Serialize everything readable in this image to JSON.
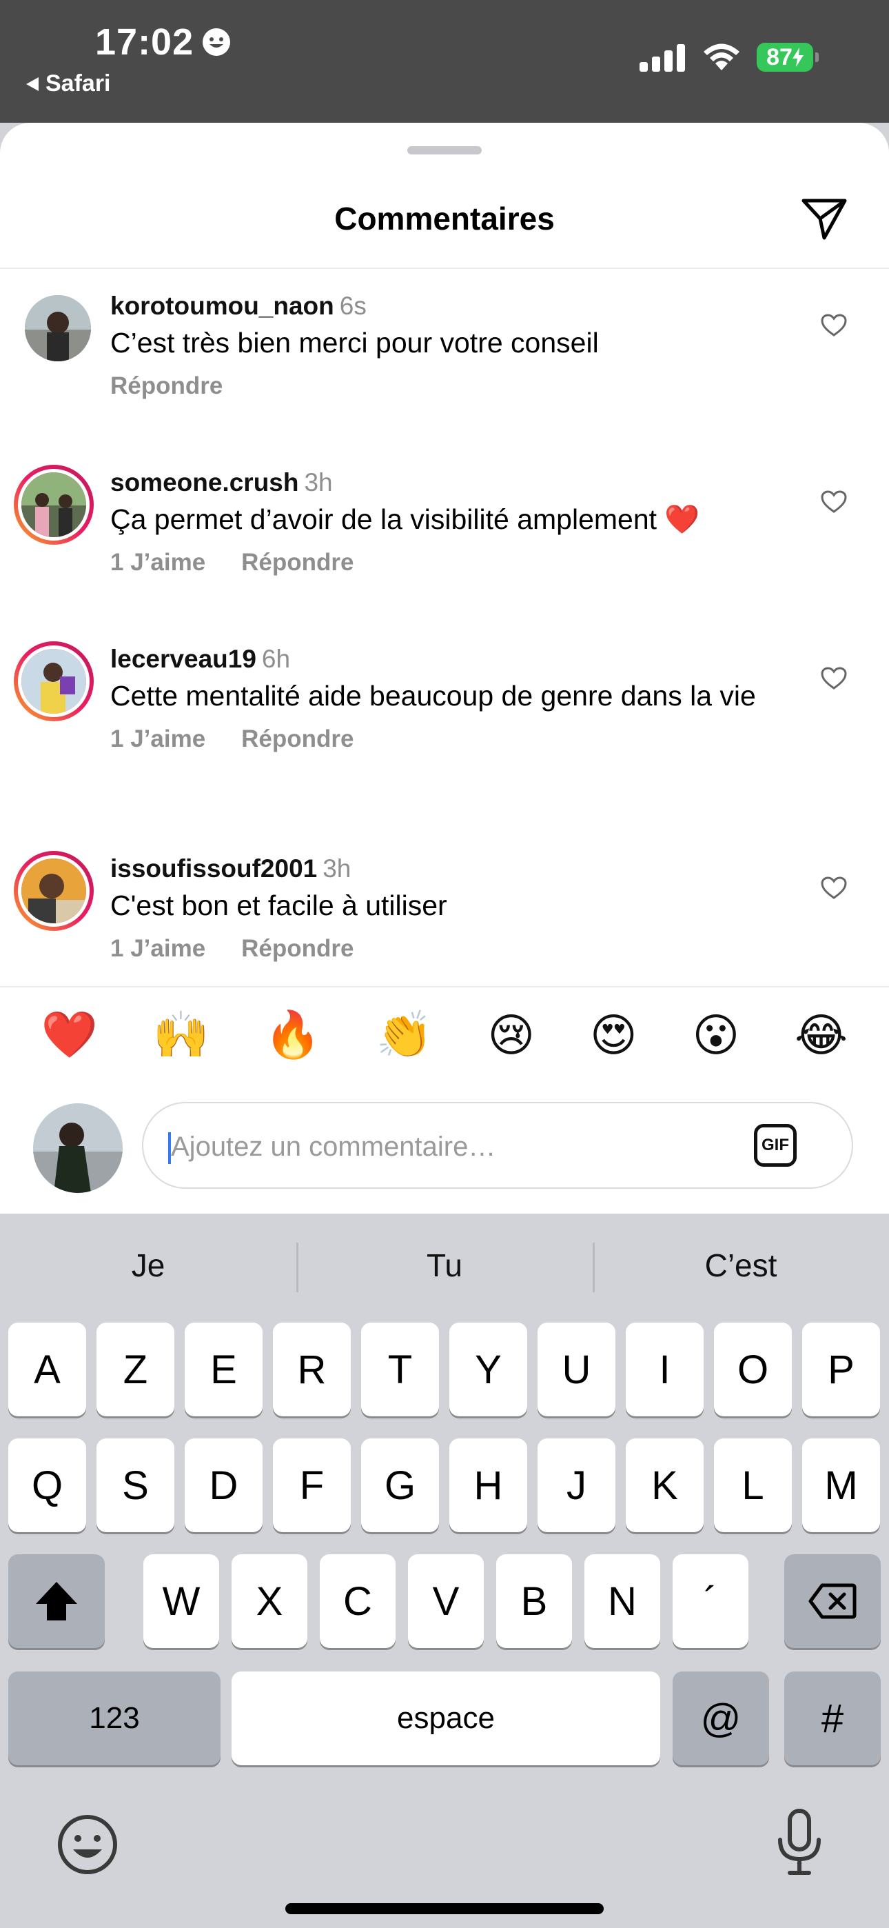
{
  "status_bar": {
    "time": "17:02",
    "back_app": "Safari",
    "battery": "87"
  },
  "sheet": {
    "title": "Commentaires"
  },
  "comments": [
    {
      "username": "korotoumou_naon",
      "time": "6s",
      "text": "C’est très bien merci pour votre conseil",
      "likes": "",
      "reply": "Répondre"
    },
    {
      "username": "someone.crush",
      "time": "3h",
      "text": "Ça permet d’avoir de la visibilité amplement ❤️",
      "likes": "1 J’aime",
      "reply": "Répondre"
    },
    {
      "username": "lecerveau19",
      "time": "6h",
      "text": "Cette mentalité aide beaucoup de genre dans la vie",
      "likes": "1 J’aime",
      "reply": "Répondre"
    },
    {
      "username": "issoufissouf2001",
      "time": "3h",
      "text": "C'est bon et facile à utiliser",
      "likes": "1 J’aime",
      "reply": "Répondre"
    }
  ],
  "quick_emojis": [
    "❤️",
    "🙌",
    "🔥",
    "👏",
    "😢",
    "😍",
    "😮",
    "😂"
  ],
  "composer": {
    "placeholder": "Ajoutez un commentaire…",
    "gif_label": "GIF"
  },
  "keyboard": {
    "suggestions": [
      "Je",
      "Tu",
      "C’est"
    ],
    "row1": [
      "A",
      "Z",
      "E",
      "R",
      "T",
      "Y",
      "U",
      "I",
      "O",
      "P"
    ],
    "row2": [
      "Q",
      "S",
      "D",
      "F",
      "G",
      "H",
      "J",
      "K",
      "L",
      "M"
    ],
    "row3": [
      "W",
      "X",
      "C",
      "V",
      "B",
      "N",
      "´"
    ],
    "numbers_label": "123",
    "space_label": "espace",
    "at_label": "@",
    "hash_label": "#"
  },
  "icons": {
    "shift": "shift-icon",
    "backspace": "backspace-icon",
    "emoji": "emoji-keyboard-icon",
    "mic": "microphone-icon",
    "send": "paper-plane-icon",
    "heart": "heart-outline-icon"
  },
  "colors": {
    "status_bar_bg": "#4a4a4a",
    "battery": "#35c759",
    "keyboard_bg": "#d1d3d9",
    "caret": "#3478f6"
  }
}
